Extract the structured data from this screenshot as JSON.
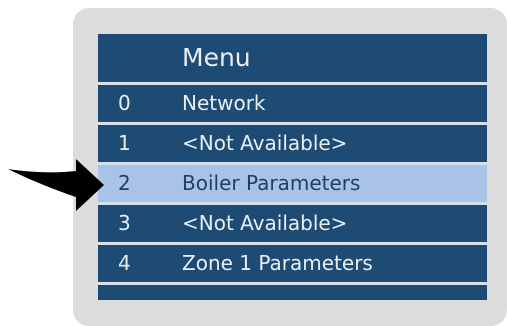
{
  "menu": {
    "title": "Menu",
    "items": [
      {
        "index": "0",
        "label": "Network"
      },
      {
        "index": "1",
        "label": "<Not Available>"
      },
      {
        "index": "2",
        "label": "Boiler Parameters"
      },
      {
        "index": "3",
        "label": "<Not Available>"
      },
      {
        "index": "4",
        "label": "Zone 1 Parameters"
      }
    ],
    "selected_index": 2
  },
  "colors": {
    "screen_bg": "#1e4b73",
    "selected_bg": "#a9c3e6",
    "text": "#e8eef6",
    "frame": "#dcdcdc"
  },
  "icons": {
    "pointer": "curved-arrow-right-icon"
  }
}
